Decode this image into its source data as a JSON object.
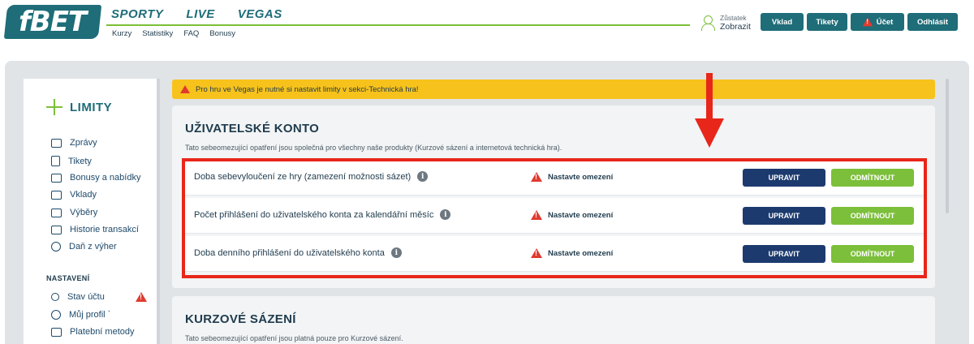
{
  "header": {
    "logo_text": "fBET",
    "main_nav": [
      "SPORTY",
      "LIVE",
      "VEGAS"
    ],
    "sub_nav": [
      "Kurzy",
      "Statistiky",
      "FAQ",
      "Bonusy"
    ],
    "balance_label": "Zůstatek",
    "balance_value": "Zobrazit",
    "buttons": {
      "deposit": "Vklad",
      "tickets": "Tikety",
      "account": "Účet",
      "logout": "Odhlásit"
    }
  },
  "sidebar": {
    "title": "LIMITY",
    "items": [
      "Zprávy",
      "Tikety",
      "Bonusy a nabídky",
      "Vklady",
      "Výběry",
      "Historie transakcí",
      "Daň z výher"
    ],
    "section_title": "NASTAVENÍ",
    "settings_items": [
      "Stav účtu",
      "Můj profil `",
      "Platební metody"
    ]
  },
  "banner": {
    "text": "Pro hru ve Vegas je nutné si nastavit limity v sekci-Technická hra!"
  },
  "account_section": {
    "title": "UŽIVATELSKÉ KONTO",
    "description": "Tato sebeomezující opatření jsou společná pro všechny naše produkty (Kurzové sázení a internetová technická hra).",
    "rows": [
      {
        "label": "Doba sebevyloučení ze hry (zamezení možnosti sázet)",
        "status": "Nastavte omezení",
        "edit": "UPRAVIT",
        "refuse": "ODMÍTNOUT"
      },
      {
        "label": "Počet přihlášení do uživatelského konta za kalendářní měsíc",
        "status": "Nastavte omezení",
        "edit": "UPRAVIT",
        "refuse": "ODMÍTNOUT"
      },
      {
        "label": "Doba denního přihlášení do uživatelského konta",
        "status": "Nastavte omezení",
        "edit": "UPRAVIT",
        "refuse": "ODMÍTNOUT"
      }
    ]
  },
  "betting_section": {
    "title": "KURZOVÉ SÁZENÍ",
    "description": "Tato sebeomezující opatření jsou platná pouze pro Kurzové sázení."
  },
  "colors": {
    "brand": "#1e6d78",
    "accent_green": "#7cbf3a",
    "navy": "#1c3a6e",
    "warning": "#f7c21b",
    "alert_red": "#e03a2f",
    "highlight_red": "#e8261a"
  }
}
